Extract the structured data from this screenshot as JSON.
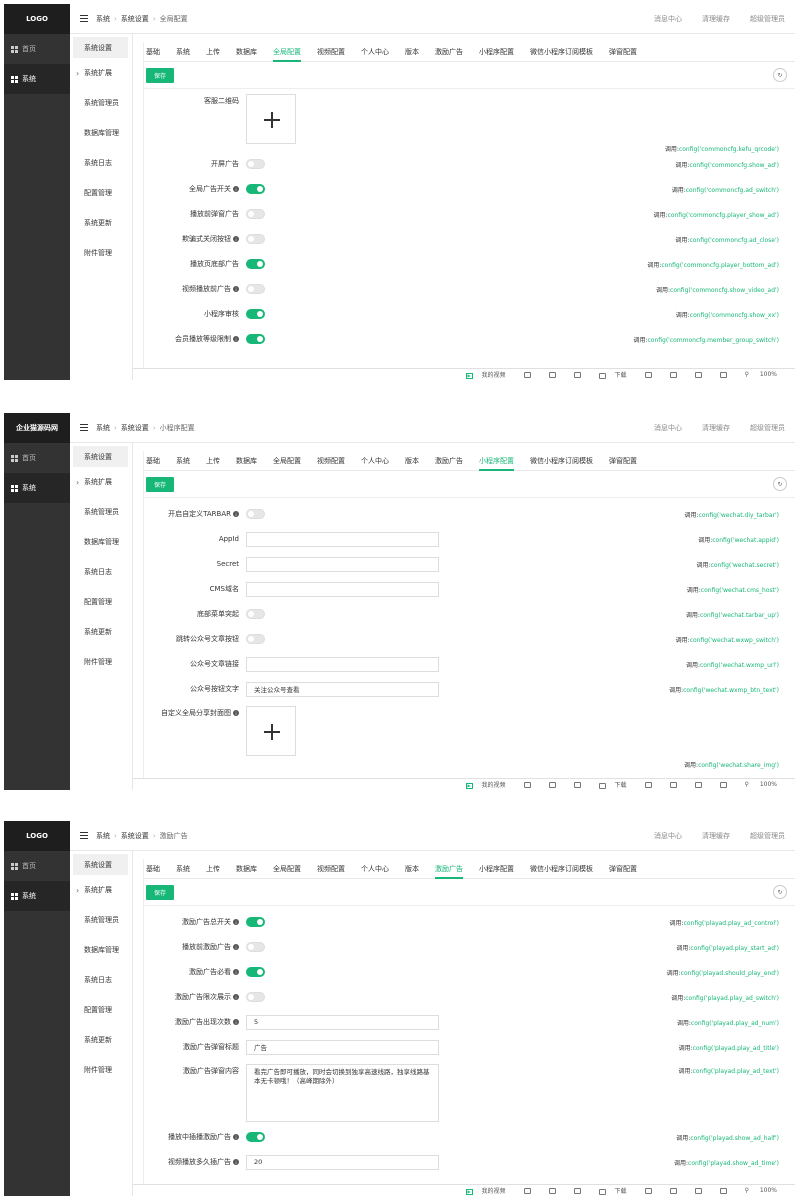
{
  "panels": [
    {
      "logo": "LOGO",
      "sidebar": [
        "首页",
        "系统"
      ],
      "submenu": [
        "系统设置",
        "系统扩展",
        "系统管理员",
        "数据库管理",
        "系统日志",
        "配置管理",
        "系统更新",
        "附件管理"
      ],
      "breadcrumb": [
        "系统",
        "系统设置",
        "全局配置"
      ],
      "header_right": [
        "消息中心",
        "清理缓存",
        "超级管理员"
      ],
      "tabs": [
        "基础",
        "系统",
        "上传",
        "数据库",
        "全局配置",
        "视频配置",
        "个人中心",
        "版本",
        "激励广告",
        "小程序配置",
        "微信小程序订阅模板",
        "弹窗配置"
      ],
      "active_tab": 4,
      "save_label": "保存",
      "rows": [
        {
          "label": "客服二维码",
          "type": "upload",
          "call_prefix": "调用:",
          "call": "config('commoncfg.kefu_qrcode')"
        },
        {
          "label": "开屏广告",
          "type": "switch",
          "on": false,
          "call_prefix": "调用:",
          "call": "config('commoncfg.show_ad')"
        },
        {
          "label": "全局广告开关",
          "info": true,
          "type": "switch",
          "on": true,
          "call_prefix": "调用:",
          "call": "config('commoncfg.ad_switch')"
        },
        {
          "label": "播放前弹窗广告",
          "type": "switch",
          "on": false,
          "call_prefix": "调用:",
          "call": "config('commoncfg.player_show_ad')"
        },
        {
          "label": "欺骗式关闭按钮",
          "info": true,
          "type": "switch",
          "on": false,
          "call_prefix": "调用:",
          "call": "config('commoncfg.ad_close')"
        },
        {
          "label": "播放页底部广告",
          "type": "switch",
          "on": true,
          "call_prefix": "调用:",
          "call": "config('commoncfg.player_bottom_ad')"
        },
        {
          "label": "视频播放前广告",
          "info": true,
          "type": "switch",
          "on": false,
          "call_prefix": "调用:",
          "call": "config('commoncfg.show_video_ad')"
        },
        {
          "label": "小程序审核",
          "type": "switch",
          "on": true,
          "call_prefix": "调用:",
          "call": "config('commoncfg.show_xx')"
        },
        {
          "label": "会员播放等级限制",
          "info": true,
          "type": "switch",
          "on": true,
          "call_prefix": "调用:",
          "call": "config('commoncfg.member_group_switch')"
        }
      ],
      "statusbar": [
        "我的视频",
        "下载",
        "100%"
      ]
    },
    {
      "logo": "企业猫源码网",
      "sidebar": [
        "首页",
        "系统"
      ],
      "submenu": [
        "系统设置",
        "系统扩展",
        "系统管理员",
        "数据库管理",
        "系统日志",
        "配置管理",
        "系统更新",
        "附件管理"
      ],
      "breadcrumb": [
        "系统",
        "系统设置",
        "小程序配置"
      ],
      "header_right": [
        "消息中心",
        "清理缓存",
        "超级管理员"
      ],
      "tabs": [
        "基础",
        "系统",
        "上传",
        "数据库",
        "全局配置",
        "视频配置",
        "个人中心",
        "版本",
        "激励广告",
        "小程序配置",
        "微信小程序订阅模板",
        "弹窗配置"
      ],
      "active_tab": 9,
      "save_label": "保存",
      "rows": [
        {
          "label": "开启自定义TARBAR",
          "info": true,
          "type": "switch",
          "on": false,
          "call_prefix": "调用:",
          "call": "config('wechat.diy_tarbar')"
        },
        {
          "label": "AppId",
          "type": "input",
          "value": "",
          "call_prefix": "调用:",
          "call": "config('wechat.appid')"
        },
        {
          "label": "Secret",
          "type": "input",
          "value": "",
          "call_prefix": "调用:",
          "call": "config('wechat.secret')"
        },
        {
          "label": "CMS域名",
          "type": "input",
          "value": "",
          "call_prefix": "调用:",
          "call": "config('wechat.cms_host')"
        },
        {
          "label": "底部菜单突起",
          "type": "switch",
          "on": false,
          "call_prefix": "调用:",
          "call": "config('wechat.tarbar_up')"
        },
        {
          "label": "跳转公众号文章按钮",
          "type": "switch",
          "on": false,
          "call_prefix": "调用:",
          "call": "config('wechat.wxwp_switch')"
        },
        {
          "label": "公众号文章链接",
          "type": "input",
          "value": "",
          "call_prefix": "调用:",
          "call": "config('wechat.wxmp_url')"
        },
        {
          "label": "公众号按钮文字",
          "type": "input",
          "value": "关注公众号查看",
          "call_prefix": "调用:",
          "call": "config('wechat.wxmp_btn_text')"
        },
        {
          "label": "自定义全局分享封面图",
          "info": true,
          "type": "upload",
          "call_prefix": "调用:",
          "call": "config('wechat.share_img')"
        }
      ],
      "statusbar": [
        "我的视频",
        "下载",
        "100%"
      ]
    },
    {
      "logo": "LOGO",
      "sidebar": [
        "首页",
        "系统"
      ],
      "submenu": [
        "系统设置",
        "系统扩展",
        "系统管理员",
        "数据库管理",
        "系统日志",
        "配置管理",
        "系统更新",
        "附件管理"
      ],
      "breadcrumb": [
        "系统",
        "系统设置",
        "激励广告"
      ],
      "header_right": [
        "消息中心",
        "清理缓存",
        "超级管理员"
      ],
      "tabs": [
        "基础",
        "系统",
        "上传",
        "数据库",
        "全局配置",
        "视频配置",
        "个人中心",
        "版本",
        "激励广告",
        "小程序配置",
        "微信小程序订阅模板",
        "弹窗配置"
      ],
      "active_tab": 8,
      "save_label": "保存",
      "rows": [
        {
          "label": "激励广告总开关",
          "info": true,
          "type": "switch",
          "on": true,
          "call_prefix": "调用:",
          "call": "config('playad.play_ad_control')"
        },
        {
          "label": "播放前激励广告",
          "info": true,
          "type": "switch",
          "on": false,
          "call_prefix": "调用:",
          "call": "config('playad.play_start_ad')"
        },
        {
          "label": "激励广告必看",
          "info": true,
          "type": "switch",
          "on": true,
          "call_prefix": "调用:",
          "call": "config('playad.should_play_end')"
        },
        {
          "label": "激励广告限次展示",
          "info": true,
          "type": "switch",
          "on": false,
          "call_prefix": "调用:",
          "call": "config('playad.play_ad_switch')"
        },
        {
          "label": "激励广告出现次数",
          "info": true,
          "type": "input",
          "value": "5",
          "call_prefix": "调用:",
          "call": "config('playad.play_ad_num')"
        },
        {
          "label": "激励广告弹窗标题",
          "type": "input",
          "value": "广告",
          "call_prefix": "调用:",
          "call": "config('playad.play_ad_title')"
        },
        {
          "label": "激励广告弹窗内容",
          "type": "textarea",
          "value": "看完广告即可播放，同时会切换到独享高速线路，独享线路基本无卡顿哦！（高峰期除外）",
          "call_prefix": "调用:",
          "call": "config('playad.play_ad_text')"
        },
        {
          "label": "播放中插播激励广告",
          "info": true,
          "type": "switch",
          "on": true,
          "call_prefix": "调用:",
          "call": "config('playad.show_ad_half')"
        },
        {
          "label": "视频播放多久插广告",
          "info": true,
          "type": "input",
          "value": "20",
          "call_prefix": "调用:",
          "call": "config('playad.show_ad_time')"
        }
      ],
      "statusbar": [
        "我的视频",
        "下载",
        "100%"
      ]
    }
  ],
  "colors": {
    "accent": "#16b777",
    "sidebar": "#333333",
    "logo_bg": "#1e1e1e"
  },
  "icons": {
    "menu": "hamburger-icon",
    "home": "grid-icon",
    "refresh": "refresh-icon",
    "upload": "plus-icon",
    "info": "info-icon"
  }
}
